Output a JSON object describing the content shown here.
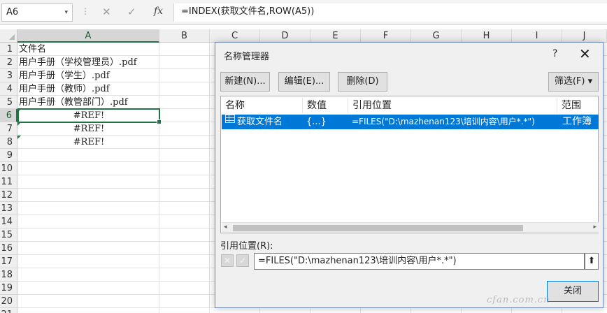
{
  "formula_bar": {
    "name_box": "A6",
    "name_box_dropdown": "▾",
    "separator": "⋮",
    "cancel_icon": "✕",
    "enter_icon": "✓",
    "fx_label": "fx",
    "formula": "=INDEX(获取文件名,ROW(A5))"
  },
  "columns": [
    "A",
    "B",
    "C",
    "D",
    "E",
    "F",
    "G",
    "H",
    "I",
    "J"
  ],
  "rows": [
    "1",
    "2",
    "3",
    "4",
    "5",
    "6",
    "7",
    "8",
    "9",
    "10",
    "11",
    "12",
    "13",
    "14",
    "15",
    "16",
    "17",
    "18",
    "19",
    "20",
    "21"
  ],
  "cells": {
    "a1": "文件名",
    "a2": "用户手册（学校管理员）.pdf",
    "a3": "用户手册（学生）.pdf",
    "a4": "用户手册（教师）.pdf",
    "a5": "用户手册（教管部门）.pdf",
    "a6": "#REF!",
    "a7": "#REF!",
    "a8": "#REF!"
  },
  "dialog": {
    "title": "名称管理器",
    "help": "?",
    "close": "✕",
    "buttons": {
      "new": "新建(N)...",
      "edit": "编辑(E)...",
      "delete": "删除(D)",
      "filter": "筛选(F) ▾"
    },
    "list": {
      "headers": [
        "名称",
        "数值",
        "引用位置",
        "范围"
      ],
      "row": {
        "name": "获取文件名",
        "value": "{...}",
        "refers_to": "=FILES(\"D:\\mazhenan123\\培训内容\\用户*.*\")",
        "scope": "工作簿"
      },
      "scroll_left": "◂",
      "scroll_right": "▸"
    },
    "refers_label": "引用位置(R):",
    "cancel_ref": "✕",
    "confirm_ref": "✓",
    "refers_value": "=FILES(\"D:\\mazhenan123\\培训内容\\用户*.*\")",
    "collapse_icon": "⬆",
    "close_button": "关闭"
  },
  "watermark": "cfan.com.cn",
  "colors": {
    "selection_blue": "#0078d7",
    "excel_green": "#217346"
  }
}
